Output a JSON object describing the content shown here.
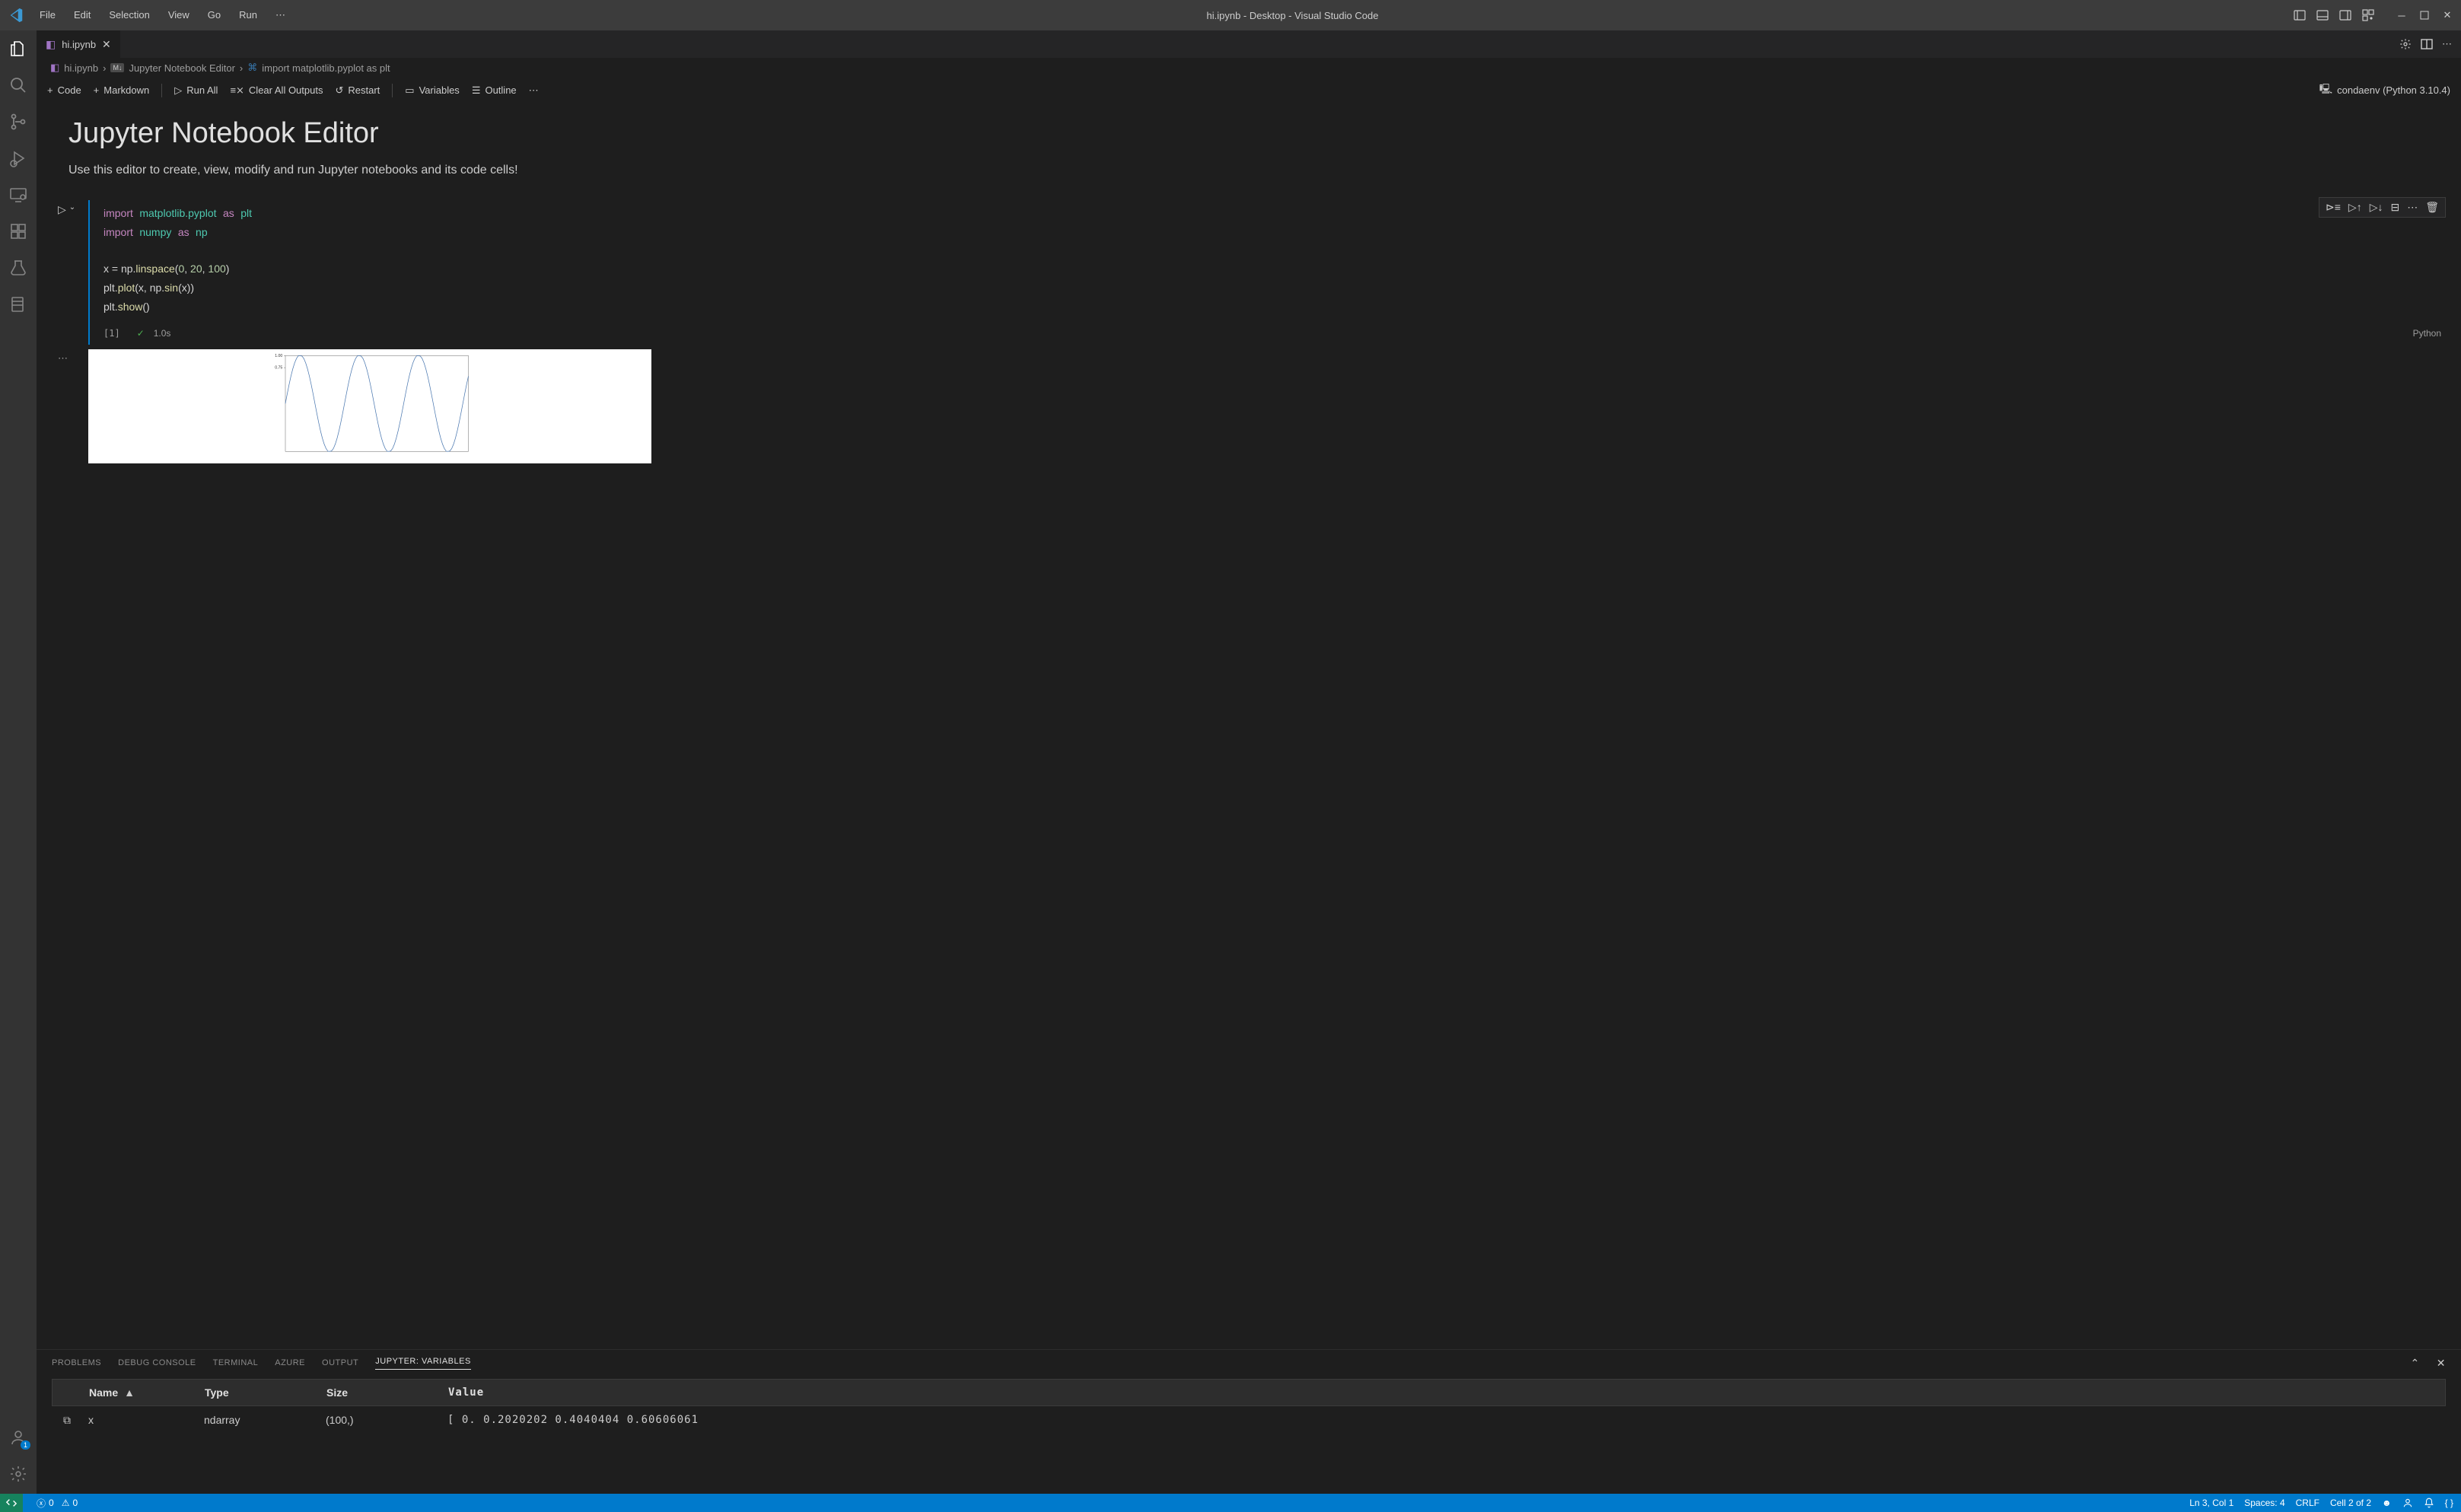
{
  "menus": {
    "file": "File",
    "edit": "Edit",
    "selection": "Selection",
    "view": "View",
    "go": "Go",
    "run": "Run"
  },
  "window_title": "hi.ipynb - Desktop - Visual Studio Code",
  "tab": {
    "name": "hi.ipynb"
  },
  "breadcrumb": {
    "file": "hi.ipynb",
    "section": "Jupyter Notebook Editor",
    "leaf": "import matplotlib.pyplot as plt"
  },
  "nbtoolbar": {
    "code": "Code",
    "markdown": "Markdown",
    "runall": "Run All",
    "clear": "Clear All Outputs",
    "restart": "Restart",
    "variables": "Variables",
    "outline": "Outline",
    "kernel": "condaenv (Python 3.10.4)"
  },
  "notebook": {
    "title": "Jupyter Notebook Editor",
    "intro": "Use this editor to create, view, modify and run Jupyter notebooks and its code cells!",
    "exec_count": "[1]",
    "exec_time": "1.0s",
    "lang": "Python",
    "code": {
      "l1_kw": "import",
      "l1_mod": "matplotlib.pyplot",
      "l1_as": "as",
      "l1_al": "plt",
      "l2_kw": "import",
      "l2_mod": "numpy",
      "l2_as": "as",
      "l2_al": "np",
      "l4_a": "x = np.",
      "l4_fn": "linspace",
      "l4_args_a": "(",
      "l4_n1": "0",
      "l4_c1": ", ",
      "l4_n2": "20",
      "l4_c2": ", ",
      "l4_n3": "100",
      "l4_close": ")",
      "l5_a": "plt.",
      "l5_fn": "plot",
      "l5_args": "(x, np.",
      "l5_fn2": "sin",
      "l5_args2": "(x))",
      "l6_a": "plt.",
      "l6_fn": "show",
      "l6_args": "()"
    }
  },
  "panel": {
    "tabs": {
      "problems": "PROBLEMS",
      "debug": "DEBUG CONSOLE",
      "terminal": "TERMINAL",
      "azure": "AZURE",
      "output": "OUTPUT",
      "jupyter": "JUPYTER: VARIABLES"
    },
    "cols": {
      "name": "Name",
      "type": "Type",
      "size": "Size",
      "value": "Value"
    },
    "row": {
      "name": "x",
      "type": "ndarray",
      "size": "(100,)",
      "value": "[ 0.        0.2020202   0.4040404   0.60606061"
    }
  },
  "status": {
    "errors": "0",
    "warnings": "0",
    "lncol": "Ln 3, Col 1",
    "spaces": "Spaces: 4",
    "eol": "CRLF",
    "cell": "Cell 2 of 2"
  },
  "activity_badge": "1",
  "chart_data": {
    "type": "line",
    "title": "",
    "xlabel": "",
    "ylabel": "",
    "xlim": [
      0,
      20
    ],
    "ylim": [
      -1,
      1
    ],
    "y_ticks_visible": [
      0.75,
      1.0
    ],
    "x": [
      0.0,
      0.202,
      0.404,
      0.606,
      0.808,
      1.01,
      1.212,
      1.414,
      1.616,
      1.818,
      2.02,
      2.222,
      2.424,
      2.626,
      2.828,
      3.03,
      3.232,
      3.434,
      3.636,
      3.838,
      4.04,
      4.242,
      4.444,
      4.646,
      4.848,
      5.051,
      5.253,
      5.455,
      5.657,
      5.859,
      6.061,
      6.263,
      6.465,
      6.667,
      6.869,
      7.071,
      7.273,
      7.475,
      7.677,
      7.879,
      8.081,
      8.283,
      8.485,
      8.687,
      8.889,
      9.091,
      9.293,
      9.495,
      9.697,
      9.899,
      10.101,
      10.303,
      10.505,
      10.707,
      10.909,
      11.111,
      11.313,
      11.515,
      11.717,
      11.919,
      12.121,
      12.323,
      12.525,
      12.727,
      12.929,
      13.131,
      13.333,
      13.535,
      13.737,
      13.939,
      14.141,
      14.343,
      14.545,
      14.747,
      14.949,
      15.152,
      15.354,
      15.556,
      15.758,
      15.96,
      16.162,
      16.364,
      16.566,
      16.768,
      16.97,
      17.172,
      17.374,
      17.576,
      17.778,
      17.98,
      18.182,
      18.384,
      18.586,
      18.788,
      18.99,
      19.192,
      19.394,
      19.596,
      19.798,
      20.0
    ],
    "y": [
      0.0,
      0.2007,
      0.3934,
      0.5697,
      0.7224,
      0.8469,
      0.9391,
      0.9972,
      1.0,
      0.991,
      0.939,
      0.8469,
      0.7224,
      0.5697,
      0.3934,
      0.2007,
      0.0,
      -0.2007,
      -0.3934,
      -0.5697,
      -0.7224,
      -0.8469,
      -0.9391,
      -0.9972,
      -1.0,
      -0.991,
      -0.939,
      -0.8469,
      -0.7224,
      -0.5697,
      -0.3934,
      -0.2007,
      0.0,
      0.2007,
      0.3934,
      0.5697,
      0.7224,
      0.8469,
      0.9391,
      0.9972,
      1.0,
      0.991,
      0.939,
      0.8469,
      0.7224,
      0.5697,
      0.3934,
      0.2007,
      0.0,
      -0.2007,
      -0.3934,
      -0.5697,
      -0.7224,
      -0.8469,
      -0.9391,
      -0.9972,
      -1.0,
      -0.991,
      -0.939,
      -0.8469,
      -0.7224,
      -0.5697,
      -0.3934,
      -0.2007,
      0.0,
      0.2007,
      0.3934,
      0.5697,
      0.7224,
      0.8469,
      0.9391,
      0.9972,
      1.0,
      0.991,
      0.939,
      0.8469,
      0.7224,
      0.5697,
      0.3934,
      0.2007,
      0.0,
      -0.2007,
      -0.3934,
      -0.5697,
      -0.7224,
      -0.8469,
      -0.9391,
      -0.9972,
      -1.0,
      -0.991,
      -0.939,
      -0.8469,
      -0.7224,
      -0.5697,
      -0.3934,
      -0.2007,
      0.0,
      0.2007,
      0.3934,
      0.5697
    ]
  }
}
